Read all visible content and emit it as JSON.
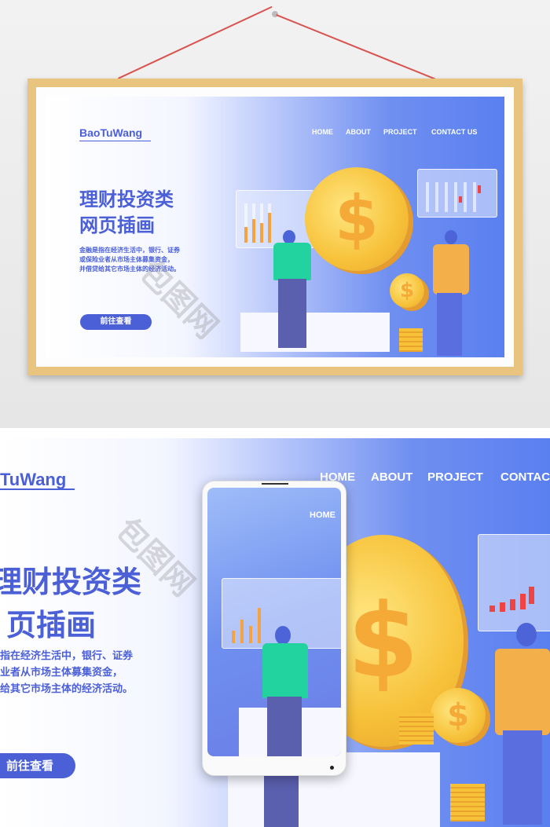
{
  "banner": {
    "logo": "BaoTuWang",
    "nav": [
      "HOME",
      "ABOUT",
      "PROJECT",
      "CONTACT US"
    ],
    "title_line1": "理财投资类",
    "title_line2": "网页插画",
    "desc_line1": "金融是指在经济生活中，银行、证券",
    "desc_line2": "或保险业者从市场主体募集资金，",
    "desc_line3": "并借贷给其它市场主体的经济活动。",
    "button": "前往查看",
    "coin_symbol": "$"
  },
  "closeup": {
    "logo": "TuWang",
    "nav": [
      "HOME",
      "ABOUT",
      "PROJECT",
      "CONTACT"
    ],
    "title_line1": "理财投资类",
    "title_line2": "页插画",
    "desc_line1": "指在经济生活中，银行、证券",
    "desc_line2": "业者从市场主体募集资金，",
    "desc_line3": "给其它市场主体的经济活动。",
    "button": "前往查看"
  },
  "phone": {
    "nav_home": "HOME"
  },
  "watermark": "包图网",
  "colors": {
    "brand": "#4b5fd6",
    "frame": "#e9c47f",
    "coin": "#f7c23a",
    "shirt": "#22d3a0"
  }
}
